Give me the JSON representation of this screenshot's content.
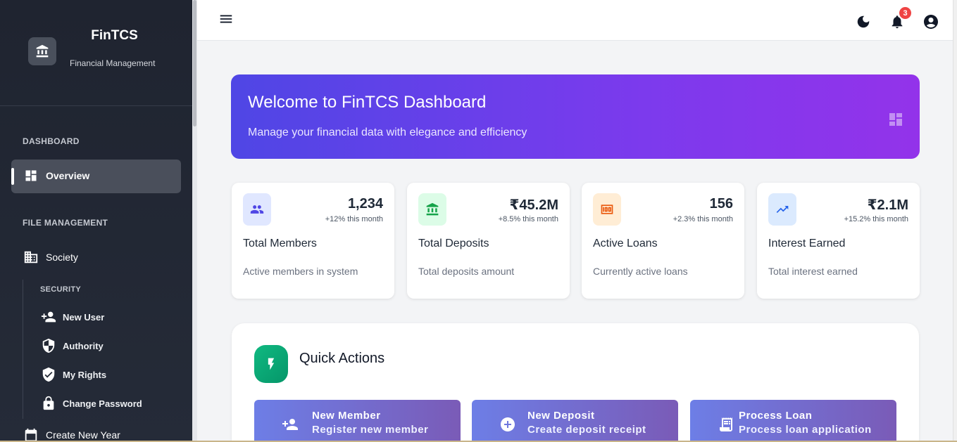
{
  "app": {
    "name": "FinTCS",
    "subtitle": "Financial Management"
  },
  "sidebar": {
    "sections": {
      "dashboard": "DASHBOARD",
      "file_management": "FILE MANAGEMENT"
    },
    "overview": "Overview",
    "society": "Society",
    "security_header": "SECURITY",
    "security_items": [
      "New User",
      "Authority",
      "My Rights",
      "Change Password"
    ],
    "create_new_year": "Create New Year"
  },
  "header": {
    "notification_count": "3"
  },
  "welcome": {
    "title": "Welcome to FinTCS Dashboard",
    "subtitle": "Manage your financial data with elegance and efficiency"
  },
  "stats": [
    {
      "value": "1,234",
      "change": "+12% this month",
      "label": "Total Members",
      "desc": "Active members in system",
      "icon": "group-icon",
      "bg": "#e0e7ff",
      "fg": "#4f46e5"
    },
    {
      "value": "₹45.2M",
      "change": "+8.5% this month",
      "label": "Total Deposits",
      "desc": "Total deposits amount",
      "icon": "bank-icon",
      "bg": "#dcfce7",
      "fg": "#16a34a"
    },
    {
      "value": "156",
      "change": "+2.3% this month",
      "label": "Active Loans",
      "desc": "Currently active loans",
      "icon": "money-icon",
      "bg": "#ffedd5",
      "fg": "#ea580c"
    },
    {
      "value": "₹2.1M",
      "change": "+15.2% this month",
      "label": "Interest Earned",
      "desc": "Total interest earned",
      "icon": "trending-up-icon",
      "bg": "#dbeafe",
      "fg": "#2563eb"
    }
  ],
  "quick_actions": {
    "title": "Quick Actions",
    "buttons": [
      {
        "title": "New Member",
        "subtitle": "Register new member",
        "icon": "person-add-icon"
      },
      {
        "title": "New Deposit",
        "subtitle": "Create deposit receipt",
        "icon": "add-circle-icon"
      },
      {
        "title": "Process Loan",
        "subtitle": "Process loan application",
        "icon": "receipt-icon"
      }
    ]
  }
}
